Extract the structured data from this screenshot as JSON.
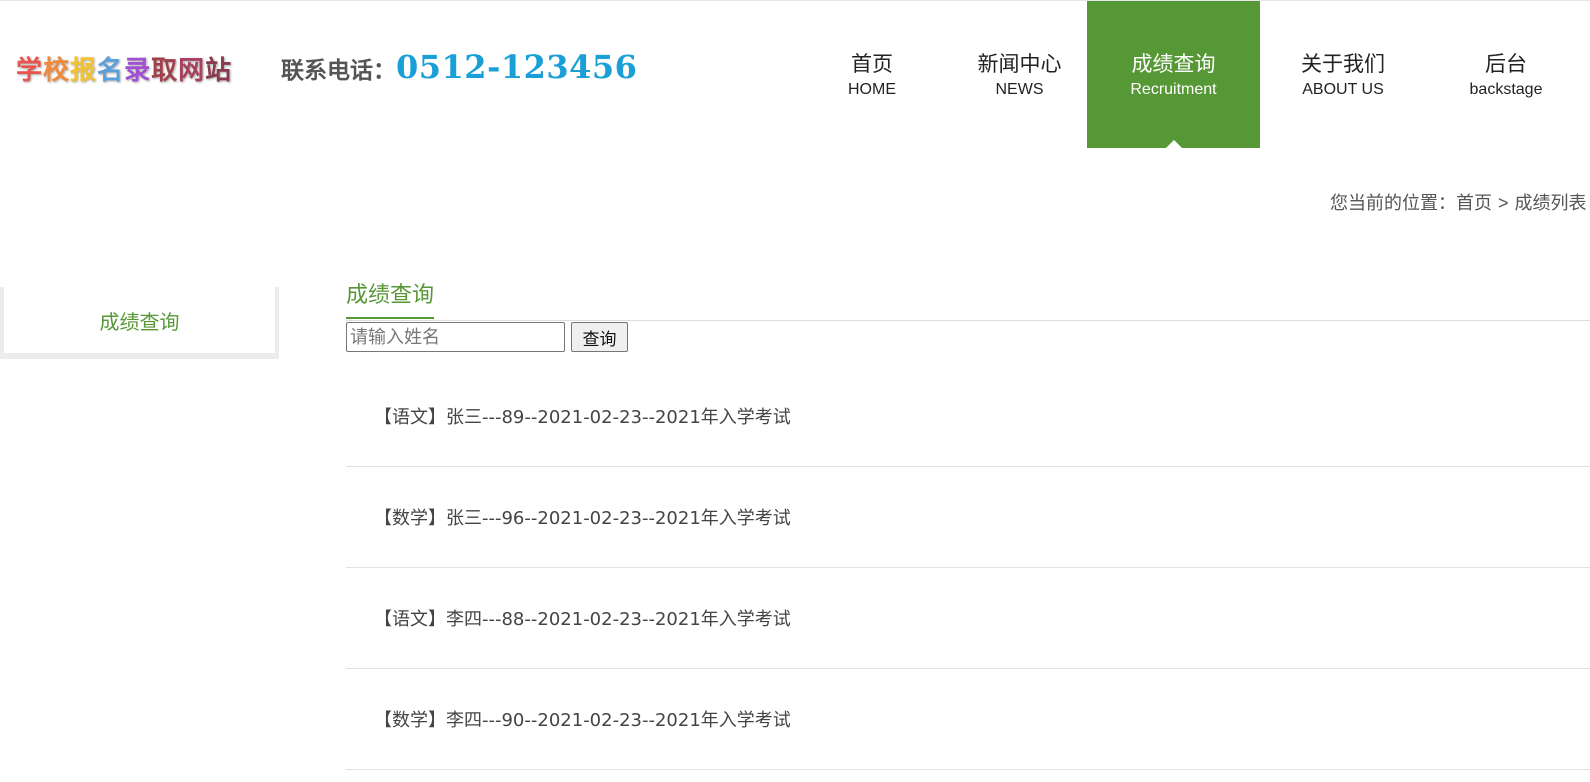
{
  "header": {
    "logo_chars": [
      {
        "char": "学",
        "color": "#e8554e"
      },
      {
        "char": "校",
        "color": "#f08a3a"
      },
      {
        "char": "报",
        "color": "#f3c230"
      },
      {
        "char": "名",
        "color": "#5aa0dc"
      },
      {
        "char": "录",
        "color": "#a050d0"
      },
      {
        "char": "取",
        "color": "#a0404a"
      },
      {
        "char": "网",
        "color": "#a84060"
      },
      {
        "char": "站",
        "color": "#8a3a50"
      }
    ],
    "contact_label": "联系电话：",
    "contact_phone": "0512-123456"
  },
  "nav": {
    "items": [
      {
        "cn": "首页",
        "en": "HOME",
        "active": false
      },
      {
        "cn": "新闻中心",
        "en": "NEWS",
        "active": false
      },
      {
        "cn": "成绩查询",
        "en": "Recruitment",
        "active": true
      },
      {
        "cn": "关于我们",
        "en": "ABOUT US",
        "active": false
      },
      {
        "cn": "后台",
        "en": "backstage",
        "active": false
      }
    ]
  },
  "breadcrumb": {
    "prefix": "您当前的位置：",
    "home": "首页",
    "separator": ">",
    "current": "成绩列表"
  },
  "sidebar": {
    "items": [
      {
        "label": "成绩查询"
      }
    ]
  },
  "main": {
    "title": "成绩查询",
    "search": {
      "placeholder": "请输入姓名",
      "value": "",
      "button_label": "查询"
    },
    "results": [
      "【语文】张三---89--2021-02-23--2021年入学考试",
      "【数学】张三---96--2021-02-23--2021年入学考试",
      "【语文】李四---88--2021-02-23--2021年入学考试",
      "【数学】李四---90--2021-02-23--2021年入学考试"
    ]
  },
  "colors": {
    "accent": "#579836",
    "phone": "#1a9fd6"
  }
}
